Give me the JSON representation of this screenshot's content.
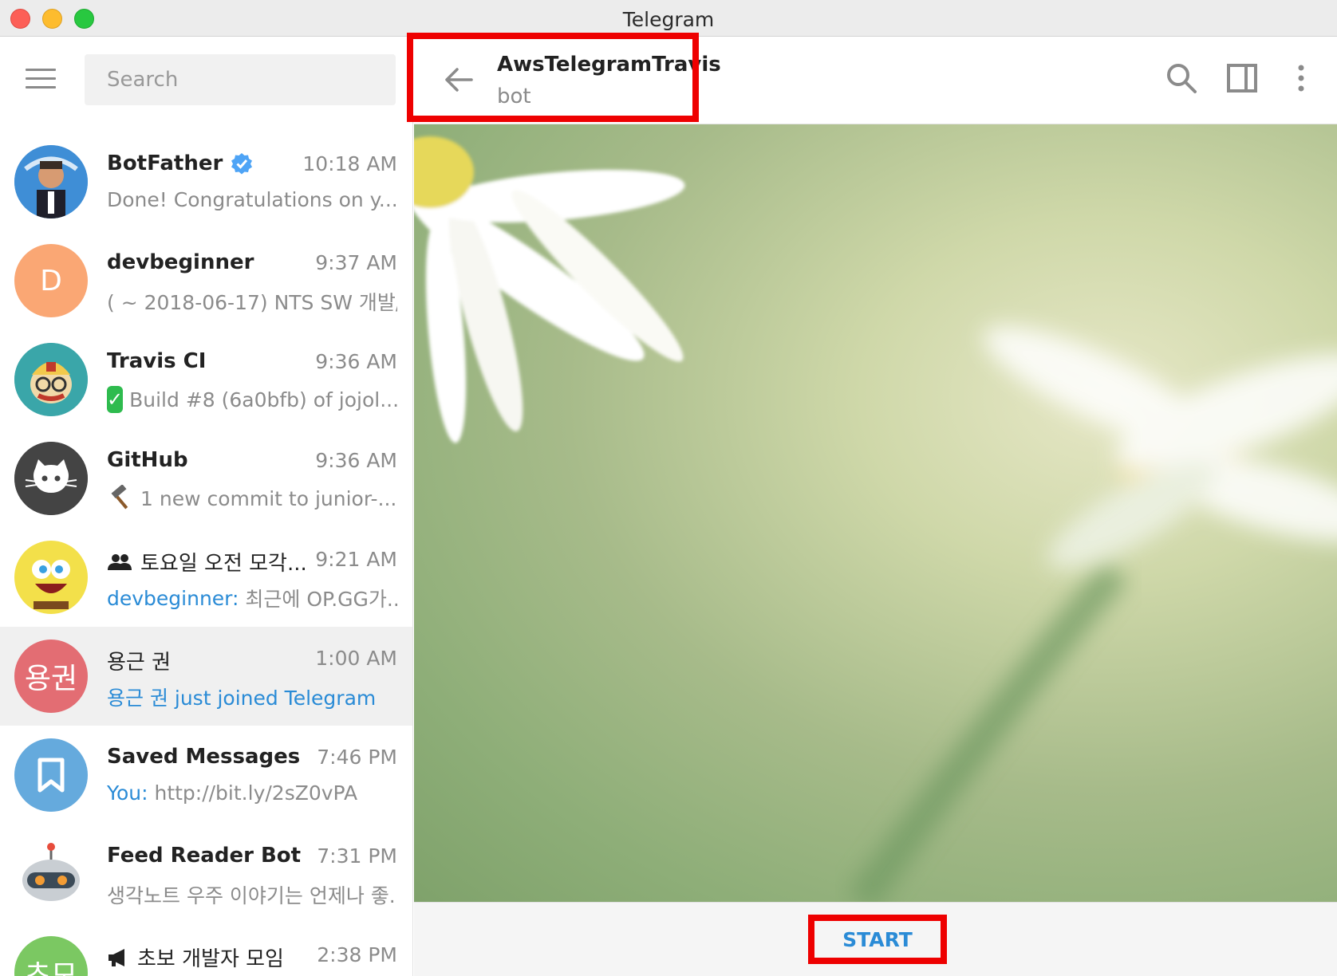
{
  "window": {
    "title": "Telegram"
  },
  "search": {
    "placeholder": "Search"
  },
  "chats": [
    {
      "name": "BotFather",
      "time": "10:18 AM",
      "preview": "Done! Congratulations on y...",
      "preview_prefix": "",
      "avatar_text": "",
      "avatar_color": "#3f8ed6",
      "verified": true
    },
    {
      "name": "devbeginner",
      "time": "9:37 AM",
      "preview": "( ~ 2018-06-17) NTS SW 개발/...",
      "preview_prefix": "",
      "avatar_text": "D",
      "avatar_color": "#faa774"
    },
    {
      "name": "Travis CI",
      "time": "9:36 AM",
      "preview": "Build #8 (6a0bfb) of jojol...",
      "preview_prefix": "",
      "avatar_text": "",
      "avatar_color": "#3aa6a9",
      "preview_icon": "check-mark-emoji"
    },
    {
      "name": "GitHub",
      "time": "9:36 AM",
      "preview": "1 new commit to junior-...",
      "preview_prefix": "",
      "avatar_text": "",
      "avatar_color": "#444444",
      "preview_icon": "hammer-emoji"
    },
    {
      "name": "토요일 오전 모각...",
      "time": "9:21 AM",
      "preview": "최근에 OP.GG가...",
      "preview_prefix": "devbeginner: ",
      "avatar_text": "",
      "avatar_color": "#f3e04a",
      "name_icon": "group-icon"
    },
    {
      "name": "용근 권",
      "time": "1:00 AM",
      "preview": "용근 권 just joined Telegram",
      "preview_prefix": "",
      "avatar_text": "용권",
      "avatar_color": "#e36d73",
      "active": true,
      "preview_highlight": true
    },
    {
      "name": "Saved Messages",
      "time": "7:46 PM",
      "preview": "http://bit.ly/2sZ0vPA",
      "preview_prefix": "You: ",
      "avatar_text": "",
      "avatar_color": "#65aadd"
    },
    {
      "name": "Feed Reader Bot",
      "time": "7:31 PM",
      "preview": "생각노트 우주 이야기는 언제나 좋...",
      "preview_prefix": "",
      "avatar_text": "",
      "avatar_color": "#ffffff"
    },
    {
      "name": "초보 개발자 모임",
      "time": "2:38 PM",
      "preview": "",
      "preview_prefix": "",
      "avatar_text": "초모",
      "avatar_color": "#7bc862",
      "name_icon": "megaphone-icon"
    }
  ],
  "header": {
    "peer_name": "AwsTelegramTravis",
    "peer_status": "bot"
  },
  "bottom": {
    "start_label": "START"
  },
  "colors": {
    "accent": "#2a8bd6",
    "highlight": "#ee0000"
  }
}
